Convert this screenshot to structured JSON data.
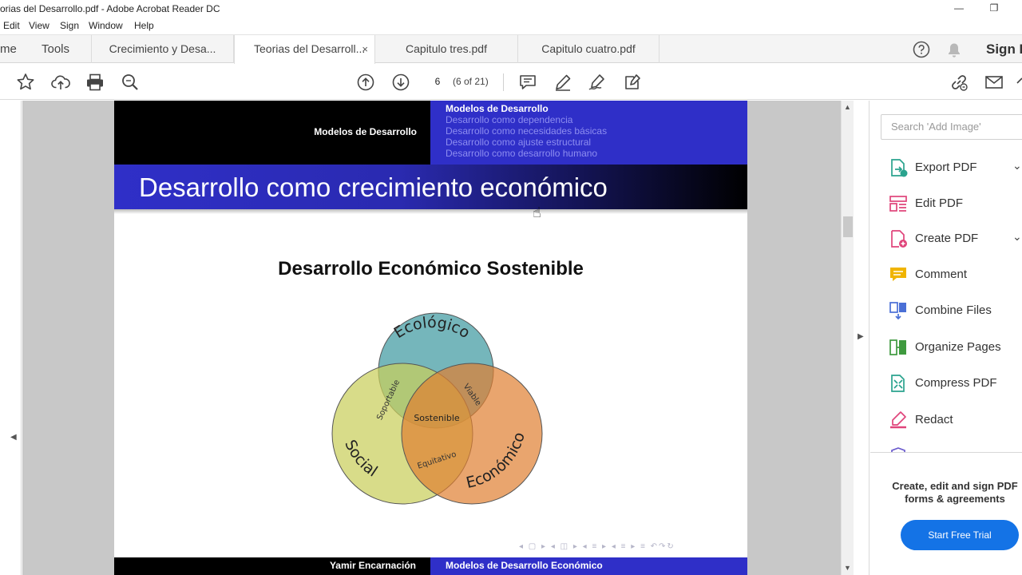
{
  "window": {
    "title": "orias del Desarrollo.pdf - Adobe Acrobat Reader DC",
    "minimize_glyph": "—",
    "maximize_glyph": "❐"
  },
  "menu": [
    "Edit",
    "View",
    "Sign",
    "Window",
    "Help"
  ],
  "nav": {
    "home": "me",
    "tools": "Tools"
  },
  "tabs": [
    {
      "label": "Crecimiento y Desa...",
      "active": false
    },
    {
      "label": "Teorias del Desarroll...",
      "active": true,
      "close": "×"
    },
    {
      "label": "Capitulo tres.pdf",
      "active": false
    },
    {
      "label": "Capitulo cuatro.pdf",
      "active": false
    }
  ],
  "header_right": {
    "sign_in": "Sign I"
  },
  "toolbar": {
    "page_value": "6",
    "page_count": "(6 of 21)"
  },
  "slide": {
    "header_section": "Modelos de Desarrollo",
    "header_current": "Modelos de Desarrollo",
    "header_items": [
      "Desarrollo como dependencia",
      "Desarrollo como necesidades básicas",
      "Desarrollo como ajuste estructural",
      "Desarrollo como desarrollo humano"
    ],
    "frame_title": "Desarrollo como crecimiento económico",
    "diagram_title": "Desarrollo Económico Sostenible",
    "venn": {
      "circles": [
        {
          "label": "Ecológico",
          "color": "#6fb3b8"
        },
        {
          "label": "Social",
          "color": "#c9cf5b"
        },
        {
          "label": "Económico",
          "color": "#df7f30"
        }
      ],
      "intersections": {
        "eco_social": "Soportable",
        "eco_econ": "Viable",
        "social_econ": "Equitativo",
        "center": "Sostenible"
      }
    },
    "nav_symbols": "◂ ▢ ▸ ◂ ◫ ▸ ◂ ≡ ▸ ◂ ≡ ▸ ≡ ↶↷↻",
    "footer_author": "Yamir Encarnación",
    "footer_title": "Modelos de Desarrollo Económico"
  },
  "tools_panel": {
    "search_placeholder": "Search 'Add Image'",
    "tools": [
      {
        "label": "Export PDF",
        "icon": "export-pdf-icon",
        "color": "#2aa38e",
        "chevron": true
      },
      {
        "label": "Edit PDF",
        "icon": "edit-pdf-icon",
        "color": "#e0457b",
        "chevron": false
      },
      {
        "label": "Create PDF",
        "icon": "create-pdf-icon",
        "color": "#e0457b",
        "chevron": true
      },
      {
        "label": "Comment",
        "icon": "comment-icon",
        "color": "#f0b400",
        "chevron": false
      },
      {
        "label": "Combine Files",
        "icon": "combine-files-icon",
        "color": "#4a6fd6",
        "chevron": false
      },
      {
        "label": "Organize Pages",
        "icon": "organize-pages-icon",
        "color": "#3f9a3f",
        "chevron": false
      },
      {
        "label": "Compress PDF",
        "icon": "compress-pdf-icon",
        "color": "#2aa38e",
        "chevron": false
      },
      {
        "label": "Redact",
        "icon": "redact-icon",
        "color": "#e0457b",
        "chevron": false
      }
    ],
    "chevron_glyph": "⌄",
    "promo": "Create, edit and sign PDF forms & agreements",
    "trial_button": "Start Free Trial"
  }
}
